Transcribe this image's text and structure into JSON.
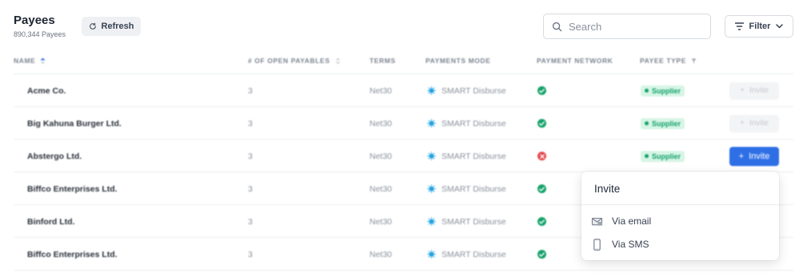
{
  "header": {
    "title": "Payees",
    "count": "890,344 Payees",
    "refresh_label": "Refresh",
    "search_placeholder": "Search",
    "filter_label": "Filter"
  },
  "columns": {
    "name": "NAME",
    "open_payables": "# OF OPEN PAYABLES",
    "terms": "TERMS",
    "payments_mode": "PAYMENTS MODE",
    "payment_network": "PAYMENT NETWORK",
    "payee_type": "PAYEE TYPE"
  },
  "rows": [
    {
      "name": "Acme Co.",
      "open": "3",
      "terms": "Net30",
      "mode": "SMART Disburse",
      "network": "ok",
      "type": "Supplier",
      "invite": "Invite"
    },
    {
      "name": "Big Kahuna Burger Ltd.",
      "open": "3",
      "terms": "Net30",
      "mode": "SMART Disburse",
      "network": "ok",
      "type": "Supplier",
      "invite": "Invite"
    },
    {
      "name": "Abstergo Ltd.",
      "open": "3",
      "terms": "Net30",
      "mode": "SMART Disburse",
      "network": "error",
      "type": "Supplier",
      "invite": "Invite"
    },
    {
      "name": "Biffco Enterprises Ltd.",
      "open": "3",
      "terms": "Net30",
      "mode": "SMART Disburse",
      "network": "ok",
      "type": "",
      "invite": ""
    },
    {
      "name": "Binford Ltd.",
      "open": "3",
      "terms": "Net30",
      "mode": "SMART Disburse",
      "network": "ok",
      "type": "",
      "invite": ""
    },
    {
      "name": "Biffco Enterprises Ltd.",
      "open": "3",
      "terms": "Net30",
      "mode": "SMART Disburse",
      "network": "ok",
      "type": "",
      "invite": ""
    }
  ],
  "dropdown": {
    "title": "Invite",
    "items": [
      {
        "label": "Via email",
        "icon": "email-icon"
      },
      {
        "label": "Via SMS",
        "icon": "phone-icon"
      }
    ]
  },
  "colors": {
    "primary": "#2f6fe6",
    "success": "#16a36a",
    "error": "#e5484d",
    "supplier_badge_bg": "#d7f5e6"
  }
}
